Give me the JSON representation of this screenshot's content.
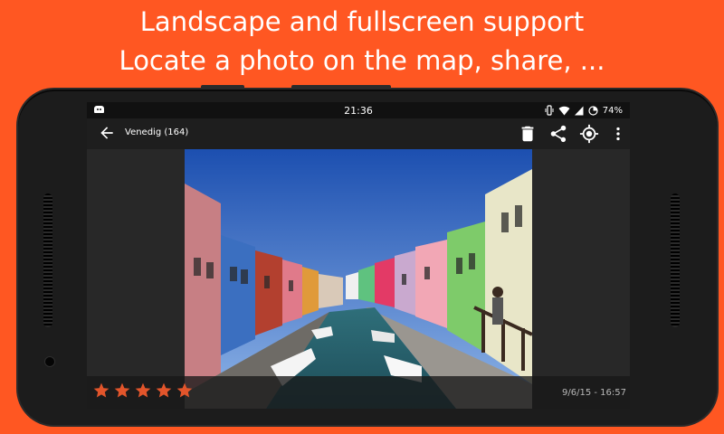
{
  "headline": {
    "line1": "Landscape and fullscreen support",
    "line2": "Locate a photo on the map, share, ..."
  },
  "statusbar": {
    "time": "21:36",
    "battery": "74%",
    "icons": [
      "vibrate-icon",
      "wifi-icon",
      "signal-icon",
      "battery-saver-icon"
    ]
  },
  "toolbar": {
    "back_icon": "arrow-back-icon",
    "title": "Venedig (164)",
    "actions": [
      "delete-icon",
      "share-icon",
      "locate-icon",
      "more-vert-icon"
    ]
  },
  "photo": {
    "subject": "canal-with-colorful-houses"
  },
  "bottombar": {
    "rating": 5,
    "rating_max": 5,
    "datetime": "9/6/15 - 16:57"
  },
  "colors": {
    "background": "#ff5722",
    "star": "#e2552b",
    "phone_body": "#1c1c1c"
  }
}
